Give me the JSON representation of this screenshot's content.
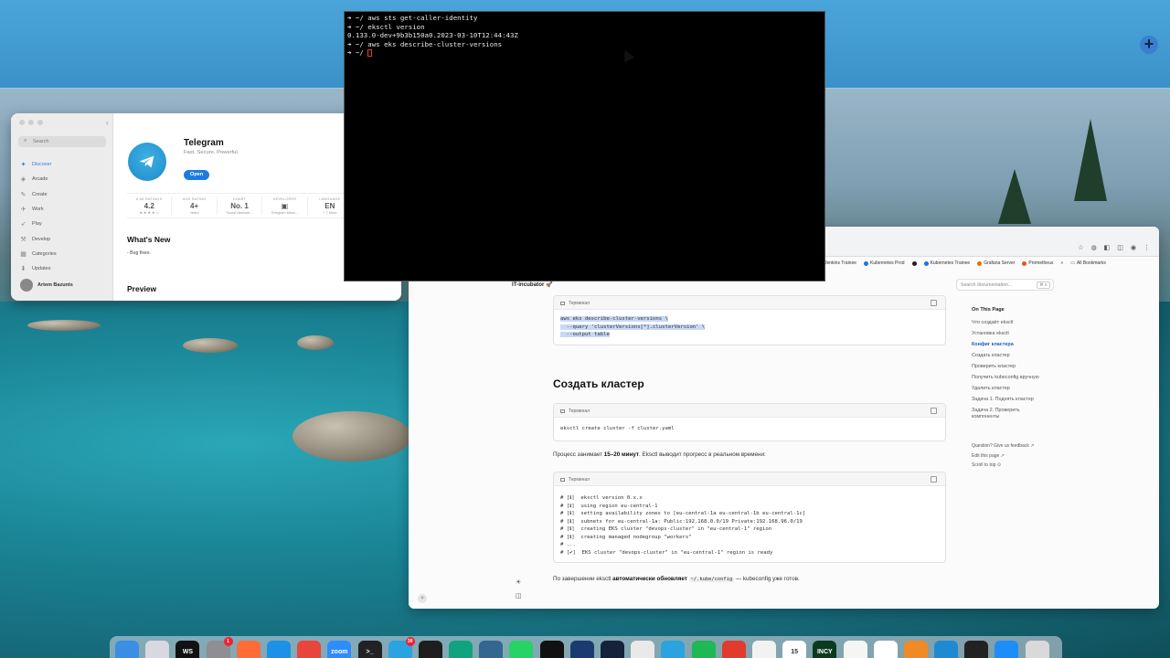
{
  "terminal": {
    "lines": [
      {
        "prompt": "➜ ~/",
        "text": "aws sts get-caller-identity"
      },
      {
        "prompt": "➜ ~/",
        "text": "eksctl version"
      },
      {
        "prompt": "",
        "text": "0.133.0-dev+9b3b150a0.2023-03-10T12:44:43Z"
      },
      {
        "prompt": "➜ ~/",
        "text": "aws eks describe-cluster-versions"
      },
      {
        "prompt": "➜ ~/",
        "text": ""
      }
    ]
  },
  "appstore": {
    "search_placeholder": "Search",
    "nav": [
      "Discover",
      "Arcade",
      "Create",
      "Work",
      "Play",
      "Develop",
      "Categories",
      "Updates"
    ],
    "user": "Artem Bazunts",
    "app_name": "Telegram",
    "app_tagline": "Fast. Secure. Powerful.",
    "open_label": "Open",
    "stats": [
      {
        "label": "6.6K RATINGS",
        "value": "4.2",
        "sub": "★ ★ ★ ★ ☆"
      },
      {
        "label": "AGE RATING",
        "value": "4+",
        "sub": "Years"
      },
      {
        "label": "CHART",
        "value": "No. 1",
        "sub": "Social Network..."
      },
      {
        "label": "DEVELOPER",
        "value": "▣",
        "sub": "Telegram Mess..."
      },
      {
        "label": "LANGUAGE",
        "value": "EN",
        "sub": "+ 7 More"
      }
    ],
    "whats_new": "What's New",
    "bug_fixes": "- Bug fixes.",
    "preview": "Preview"
  },
  "browser": {
    "bookmarks": [
      "Jenkins Trainee",
      "Kubernetes Prod",
      "Kubernetes Trainee",
      "Grafana Server",
      "Prometheus",
      "»",
      "All Bookmarks"
    ],
    "brand": "IT-incubator 🚀",
    "search_docs": "Search documentation...",
    "search_kbd": "⌘ K",
    "code1": {
      "label": "Терминал",
      "lines": [
        "aws eks describe-cluster-versions \\",
        "  --query 'clusterVersions[*].clusterVersion' \\",
        "  --output table"
      ]
    },
    "heading": "Создать кластер",
    "code2": {
      "label": "Терминал",
      "lines": [
        "eksctl create cluster -f cluster.yaml"
      ]
    },
    "para1_pre": "Процесс занимает ",
    "para1_bold": "15–20 минут",
    "para1_post": ". Eksctl выводит прогресс в реальном времени:",
    "code3": {
      "label": "Терминал",
      "lines": [
        "# [ℹ]  eksctl version 0.x.x",
        "# [ℹ]  using region eu-central-1",
        "# [ℹ]  setting availability zones to [eu-central-1a eu-central-1b eu-central-1c]",
        "# [ℹ]  subnets for eu-central-1a: Public:192.168.0.0/19 Private:192.168.96.0/19",
        "# [ℹ]  creating EKS cluster \"devops-cluster\" in \"eu-central-1\" region",
        "# [ℹ]  creating managed nodegroup \"workers\"",
        "# ...",
        "# [✔]  EKS cluster \"devops-cluster\" in \"eu-central-1\" region is ready"
      ]
    },
    "para2_pre": "По завершении eksctl ",
    "para2_bold": "автоматически обновляет",
    "para2_code": "~/.kube/config",
    "para2_post": " — kubeconfig уже готов.",
    "toc_title": "On This Page",
    "toc": [
      "Что создаёт eksctl",
      "Установка eksctl",
      "Конфиг кластера",
      "Создать кластер",
      "Проверить кластер",
      "Получить kubeconfig вручную",
      "Удалить кластер",
      "Задача 1. Поднять кластер",
      "Задача 2. Проверить компоненты"
    ],
    "toc_active_index": 2,
    "feedback": "Question? Give us feedback ↗",
    "edit_page": "Edit this page ↗",
    "scroll_top": "Scroll to top ⊙"
  },
  "dock": {
    "apps": [
      {
        "name": "finder",
        "color": "#3a8ee6",
        "label": ""
      },
      {
        "name": "launchpad",
        "color": "#d8d8e0",
        "label": ""
      },
      {
        "name": "webstorm",
        "color": "#111111",
        "label": "WS"
      },
      {
        "name": "system-settings",
        "color": "#8e8e93",
        "label": "",
        "badge": "1"
      },
      {
        "name": "postman",
        "color": "#ff6c37",
        "label": ""
      },
      {
        "name": "docker",
        "color": "#1d91e6",
        "label": ""
      },
      {
        "name": "chrome",
        "color": "#e8453c",
        "label": ""
      },
      {
        "name": "zoom",
        "color": "#2d8cff",
        "label": "zoom"
      },
      {
        "name": "terminal",
        "color": "#222222",
        "label": ">_"
      },
      {
        "name": "telegram",
        "color": "#2aa3e0",
        "label": "",
        "badge": "39"
      },
      {
        "name": "activity-monitor",
        "color": "#1e1e1e",
        "label": ""
      },
      {
        "name": "chatgpt-green",
        "color": "#0fa37f",
        "label": ""
      },
      {
        "name": "pgadmin",
        "color": "#336791",
        "label": ""
      },
      {
        "name": "whatsapp",
        "color": "#25d366",
        "label": ""
      },
      {
        "name": "chatgpt",
        "color": "#111111",
        "label": ""
      },
      {
        "name": "notes",
        "color": "#1b3a70",
        "label": ""
      },
      {
        "name": "vpn",
        "color": "#16223a",
        "label": ""
      },
      {
        "name": "safari-like",
        "color": "#e9e9e9",
        "label": ""
      },
      {
        "name": "telegram-2",
        "color": "#2aa3e0",
        "label": ""
      },
      {
        "name": "spotify-like",
        "color": "#1db954",
        "label": ""
      },
      {
        "name": "remote",
        "color": "#e23b2e",
        "label": ""
      },
      {
        "name": "burst",
        "color": "#f2f2f2",
        "label": ""
      },
      {
        "name": "calendar",
        "color": "#ffffff",
        "label": "15"
      },
      {
        "name": "incy",
        "color": "#0b3a1e",
        "label": "INCY"
      },
      {
        "name": "notion",
        "color": "#f5f5f5",
        "label": ""
      },
      {
        "name": "github",
        "color": "#ffffff",
        "label": ""
      },
      {
        "name": "infuse",
        "color": "#f08a24",
        "label": ""
      },
      {
        "name": "vscode",
        "color": "#1f8ad2",
        "label": ""
      },
      {
        "name": "clock",
        "color": "#222222",
        "label": ""
      },
      {
        "name": "app-store",
        "color": "#1c8ef9",
        "label": ""
      },
      {
        "name": "trash",
        "color": "#d9d9d9",
        "label": ""
      }
    ]
  }
}
